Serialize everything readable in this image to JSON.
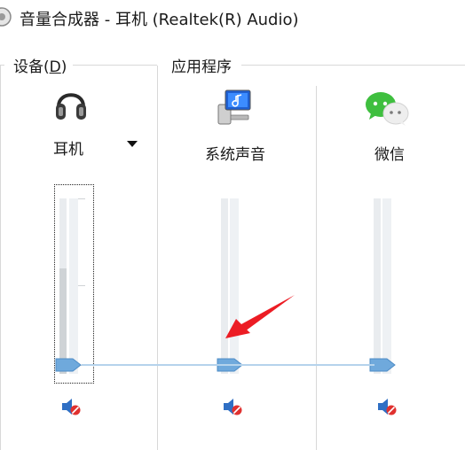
{
  "window": {
    "title": "音量合成器 - 耳机 (Realtek(R) Audio)"
  },
  "sections": {
    "device_prefix": "设备(",
    "device_accel": "D",
    "device_suffix": ")",
    "applications": "应用程序"
  },
  "device": {
    "name": "耳机",
    "icon": "headphones-icon",
    "level_pct": 60,
    "muted": true
  },
  "apps": [
    {
      "name": "系统声音",
      "icon": "system-sounds-icon",
      "level_pct": 0,
      "muted": true
    },
    {
      "name": "微信",
      "icon": "wechat-icon",
      "level_pct": 0,
      "muted": true
    }
  ],
  "colors": {
    "accent": "#6fa9dc",
    "mute_badge": "#e0312f",
    "arrow": "#ec1c24",
    "wechat": "#3fbf3f"
  }
}
